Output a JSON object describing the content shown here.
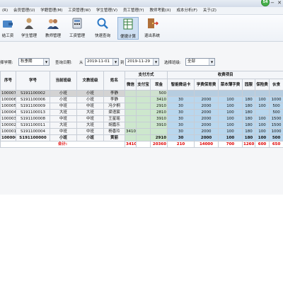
{
  "titlebar": {
    "badge": "54",
    "min": "−",
    "close": "✕"
  },
  "menu": [
    "(R)",
    "会员管理(U)",
    "学籍管理(M)",
    "工资管理(W)",
    "学生管理(V)",
    "员工管理(Y)",
    "教师考勤(X)",
    "成本分析(F)",
    "关于(Z)"
  ],
  "toolbar": [
    "结工资",
    "学生管理",
    "教师管理",
    "工资管理",
    "快速查询",
    "便捷计算",
    "退出系统"
  ],
  "filters": {
    "term_label": "择学期:",
    "term_value": "秋季期",
    "date_label": "查询日期:",
    "from_label": "从",
    "from_value": "2019-11-01",
    "to_label": "到",
    "to_value": "2019-11-29",
    "class_label": "选择班级:",
    "class_value": "全部"
  },
  "grid": {
    "headers": {
      "seq": "序号",
      "student_id": "学号",
      "current_class": "当前班级",
      "subject_class": "文教班级",
      "name": "姓名",
      "payment_group": "支付方式",
      "fee_group": "收费项目",
      "wechat": "微信",
      "alipay": "支付宝",
      "cash": "现金",
      "fees": [
        "智能微话卡",
        "学费保育费",
        "菜本薄字费",
        "园服",
        "保险费",
        "伙食"
      ]
    },
    "rows": [
      {
        "seq": "100007",
        "sid": "S191100002",
        "cur": "小班",
        "sub": "小班",
        "name": "李静",
        "wechat": "",
        "alipay": "",
        "cash": "500",
        "fees": [
          "",
          "",
          "",
          "",
          "",
          ""
        ],
        "selected": true
      },
      {
        "seq": "100006",
        "sid": "S191100006",
        "cur": "小班",
        "sub": "小班",
        "name": "李静",
        "wechat": "",
        "alipay": "",
        "cash": "3410",
        "fees": [
          "30",
          "2000",
          "100",
          "180",
          "100",
          "1000"
        ]
      },
      {
        "seq": "100005",
        "sid": "S191100009",
        "cur": "中班",
        "sub": "中班",
        "name": "冯夕桐",
        "wechat": "",
        "alipay": "",
        "cash": "2910",
        "fees": [
          "30",
          "2000",
          "100",
          "180",
          "100",
          "500"
        ]
      },
      {
        "seq": "100004",
        "sid": "S191100013",
        "cur": "大班",
        "sub": "大班",
        "name": "梁语宸",
        "wechat": "",
        "alipay": "",
        "cash": "2810",
        "fees": [
          "30",
          "2000",
          "100",
          "180",
          "",
          "500"
        ]
      },
      {
        "seq": "100003",
        "sid": "S191100008",
        "cur": "中班",
        "sub": "中班",
        "name": "王星瑶",
        "wechat": "",
        "alipay": "",
        "cash": "3910",
        "fees": [
          "30",
          "2000",
          "100",
          "180",
          "100",
          "1500"
        ]
      },
      {
        "seq": "100002",
        "sid": "S191100011",
        "cur": "大班",
        "sub": "大班",
        "name": "胡嘉乐",
        "wechat": "",
        "alipay": "",
        "cash": "3910",
        "fees": [
          "30",
          "2000",
          "100",
          "180",
          "100",
          "1500"
        ]
      },
      {
        "seq": "100001",
        "sid": "S191100004",
        "cur": "中班",
        "sub": "中班",
        "name": "杨香玲",
        "wechat": "3410",
        "alipay": "",
        "cash": "",
        "fees": [
          "30",
          "2000",
          "100",
          "180",
          "100",
          "1000"
        ]
      },
      {
        "seq": "100000",
        "sid": "S191100000",
        "cur": "小班",
        "sub": "小班",
        "name": "黄丽",
        "wechat": "",
        "alipay": "",
        "cash": "2910",
        "fees": [
          "30",
          "2000",
          "100",
          "180",
          "100",
          "500"
        ],
        "bold": true
      }
    ],
    "total": {
      "label": "合计:",
      "wechat": "3410",
      "alipay": "",
      "cash": "20360",
      "fees": [
        "210",
        "14000",
        "700",
        "1260",
        "600",
        "650"
      ]
    }
  },
  "colors": {
    "pay_bg": "#cde7cd",
    "fee_bg": "#b9d7ee",
    "total_text": "#e00000",
    "selected_row": "#d3d3d3"
  }
}
